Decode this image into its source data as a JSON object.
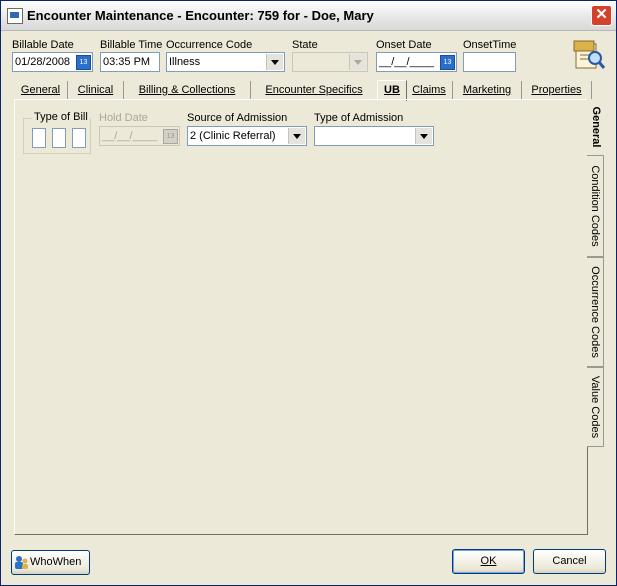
{
  "window": {
    "title": "Encounter Maintenance - Encounter: 759 for - Doe, Mary"
  },
  "header": {
    "billable_date": {
      "label": "Billable Date",
      "value": "01/28/2008"
    },
    "billable_time": {
      "label": "Billable Time",
      "value": "03:35 PM"
    },
    "occurrence_code": {
      "label": "Occurrence Code",
      "value": "Illness"
    },
    "state": {
      "label": "State",
      "value": ""
    },
    "onset_date": {
      "label": "Onset Date",
      "value": "__/__/____"
    },
    "onset_time": {
      "label": "OnsetTime",
      "value": ""
    }
  },
  "tabs": [
    "General",
    "Clinical",
    "Billing & Collections",
    "Encounter Specifics",
    "UB",
    "Claims",
    "Marketing",
    "Properties"
  ],
  "active_tab": "UB",
  "ub": {
    "type_of_bill_label": "Type of Bill",
    "hold_date": {
      "label": "Hold Date",
      "value": "__/__/____"
    },
    "source_of_admission": {
      "label": "Source of Admission",
      "value": "2  (Clinic Referral)"
    },
    "type_of_admission": {
      "label": "Type of Admission",
      "value": ""
    }
  },
  "side_tabs": [
    "General",
    "Condition Codes",
    "Occurrence Codes",
    "Value Codes"
  ],
  "footer": {
    "whowhen_label": "WhoWhen",
    "ok_label": "OK",
    "cancel_label": "Cancel"
  },
  "colors": {
    "accent": "#2a6fc9",
    "close": "#d5422b",
    "field_border": "#7f9db9"
  },
  "icons": {
    "title": "app-window-icon",
    "tool": "document-search-icon",
    "close": "close-icon",
    "whowhen": "users-info-icon"
  }
}
